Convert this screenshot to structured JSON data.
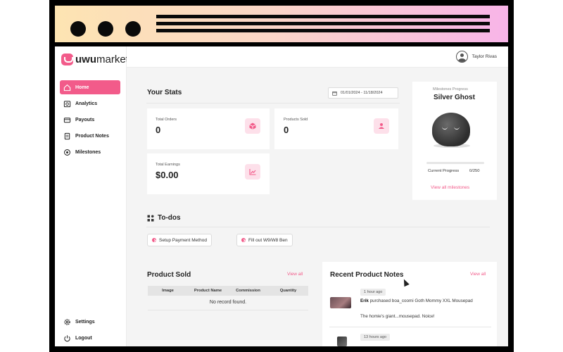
{
  "app": {
    "logo_bold": "uwu",
    "logo_rest": "market",
    "user_name": "Taylor Rivas",
    "brand_color": "#f25b8a"
  },
  "sidebar": {
    "items": [
      {
        "label": "Home",
        "icon": "home-icon",
        "active": true
      },
      {
        "label": "Analytics",
        "icon": "analytics-icon"
      },
      {
        "label": "Payouts",
        "icon": "payouts-icon"
      },
      {
        "label": "Product Notes",
        "icon": "notes-icon"
      },
      {
        "label": "Milestones",
        "icon": "milestones-icon"
      }
    ],
    "bottom": [
      {
        "label": "Settings",
        "icon": "gear-icon"
      },
      {
        "label": "Logout",
        "icon": "power-icon"
      }
    ]
  },
  "stats": {
    "title": "Your Stats",
    "date_range": "01/01/2024 - 11/18/2024",
    "total_orders_label": "Total Orders",
    "total_orders_value": "0",
    "products_sold_label": "Products Sold",
    "products_sold_value": "0",
    "total_earnings_label": "Total Earnings",
    "total_earnings_value": "$0.00"
  },
  "milestone": {
    "label": "Milestones Progress",
    "name": "Silver Ghost",
    "progress_label": "Current Progress",
    "progress_value": "0/250",
    "progress_fraction": 0,
    "link": "View all milestones"
  },
  "todos": {
    "title": "To-dos",
    "items": [
      "Setup Payment Method",
      "Fill out W9/W8 Ben"
    ]
  },
  "product_sold": {
    "title": "Product Sold",
    "view_all": "View all",
    "columns": [
      "Image",
      "Product Name",
      "Commission",
      "Quantity"
    ],
    "empty": "No record found."
  },
  "recent_notes": {
    "title": "Recent Product Notes",
    "view_all": "View all",
    "items": [
      {
        "time": "1 hour ago",
        "author": "Erik",
        "action": "purchased boa_coomi Goth Mommy XXL Mousepad",
        "comment": "The homie's giant...mousepad. Noice!"
      },
      {
        "time": "13 hours ago"
      }
    ]
  }
}
